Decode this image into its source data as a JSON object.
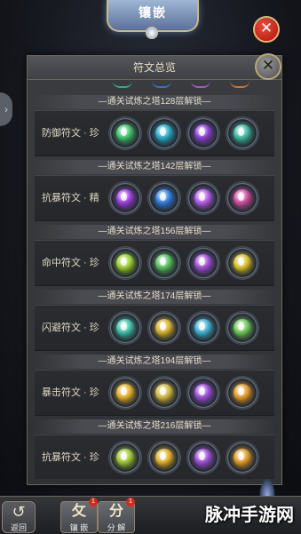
{
  "header": {
    "title": "镶嵌"
  },
  "panel": {
    "title": "符文总览",
    "sections": [
      {
        "unlock_text": "—通关试炼之塔128层解锁—",
        "rune_name": "防御符文 · 珍",
        "gems": [
          "#3fbf6a",
          "#2aa9c7",
          "#8a3fd0",
          "#3fb8a0"
        ]
      },
      {
        "unlock_text": "—通关试炼之塔142层解锁—",
        "rune_name": "抗暴符文 · 精",
        "gems": [
          "#9b3fe0",
          "#2f7fe0",
          "#b45ce8",
          "#d04fa0"
        ]
      },
      {
        "unlock_text": "—通关试炼之塔156层解锁—",
        "rune_name": "命中符文 · 珍",
        "gems": [
          "#9ccf2f",
          "#58c060",
          "#a04fd8",
          "#d6c02a"
        ]
      },
      {
        "unlock_text": "—通关试炼之塔174层解锁—",
        "rune_name": "闪避符文 · 珍",
        "gems": [
          "#3fc0a8",
          "#d4b02a",
          "#3fb0d0",
          "#6fc85a"
        ]
      },
      {
        "unlock_text": "—通关试炼之塔194层解锁—",
        "rune_name": "暴击符文 · 珍",
        "gems": [
          "#e0b02a",
          "#d0b840",
          "#9a4fd8",
          "#e39a2a"
        ]
      },
      {
        "unlock_text": "—通关试炼之塔216层解锁—",
        "rune_name": "抗暴符文 · 珍",
        "gems": [
          "#a0c830",
          "#e0b028",
          "#a04fd8",
          "#e09a28"
        ]
      }
    ]
  },
  "bottom_bar": {
    "back_label": "返回",
    "tabs": [
      {
        "glyph": "攵",
        "label": "镶 嵌",
        "badge": "1"
      },
      {
        "glyph": "分",
        "label": "分 解",
        "badge": "1"
      }
    ]
  },
  "watermark": "脉冲手游网"
}
